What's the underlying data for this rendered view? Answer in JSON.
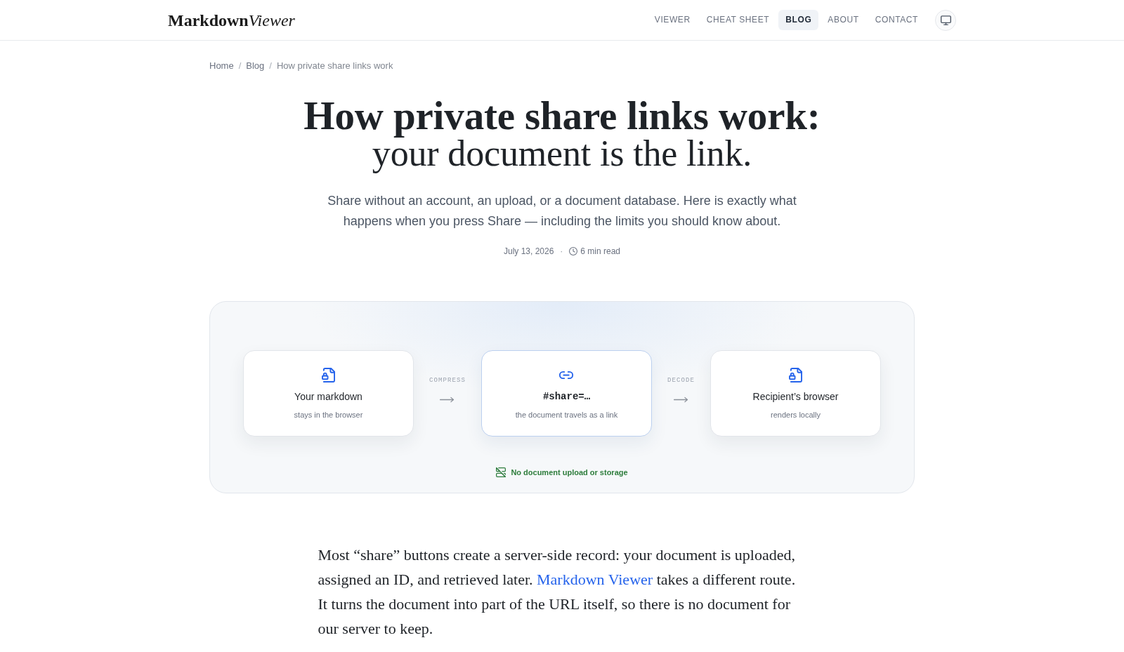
{
  "header": {
    "logo": {
      "bold_part": "Markdown",
      "italic_part": "Viewer"
    },
    "nav": [
      {
        "label": "VIEWER",
        "selected": false
      },
      {
        "label": "CHEAT SHEET",
        "selected": false
      },
      {
        "label": "BLOG",
        "selected": true
      },
      {
        "label": "ABOUT",
        "selected": false
      },
      {
        "label": "CONTACT",
        "selected": false
      }
    ]
  },
  "breadcrumb": [
    {
      "kind": "link",
      "label": "Home"
    },
    {
      "kind": "separator",
      "label": "/"
    },
    {
      "kind": "link",
      "label": "Blog"
    },
    {
      "kind": "separator",
      "label": "/"
    },
    {
      "kind": "current",
      "label": "How private share links work"
    }
  ],
  "article": {
    "title_line_1": "How private share links work:",
    "title_line_2": "your document is the link.",
    "subtitle": "Share without an account, an upload, or a document database. Here is exactly what happens when you press Share — including the limits you should know about.",
    "meta": {
      "date": "July 13, 2026",
      "separator": "·",
      "read_time": "6 min read"
    }
  },
  "diagram": {
    "steps": [
      {
        "kind": "file",
        "title": "Your markdown",
        "caption": "stays in the browser",
        "highlighted": false
      },
      {
        "kind": "link",
        "title": "#share=…",
        "caption": "the document travels as a link",
        "highlighted": true
      },
      {
        "kind": "file",
        "title": "Recipient’s browser",
        "caption": "renders locally",
        "highlighted": false
      }
    ],
    "connectors": [
      "COMPRESS",
      "DECODE"
    ],
    "note": "No document upload or storage"
  },
  "body": {
    "paragraph": [
      {
        "kind": "text",
        "text": "Most “share” buttons create a server-side record: your document is uploaded, assigned an ID, and retrieved later. "
      },
      {
        "kind": "link",
        "text": "Markdown Viewer"
      },
      {
        "kind": "text",
        "text": " takes a different route. It turns the document into part of the URL itself, so there is no document for our server to keep."
      }
    ]
  }
}
